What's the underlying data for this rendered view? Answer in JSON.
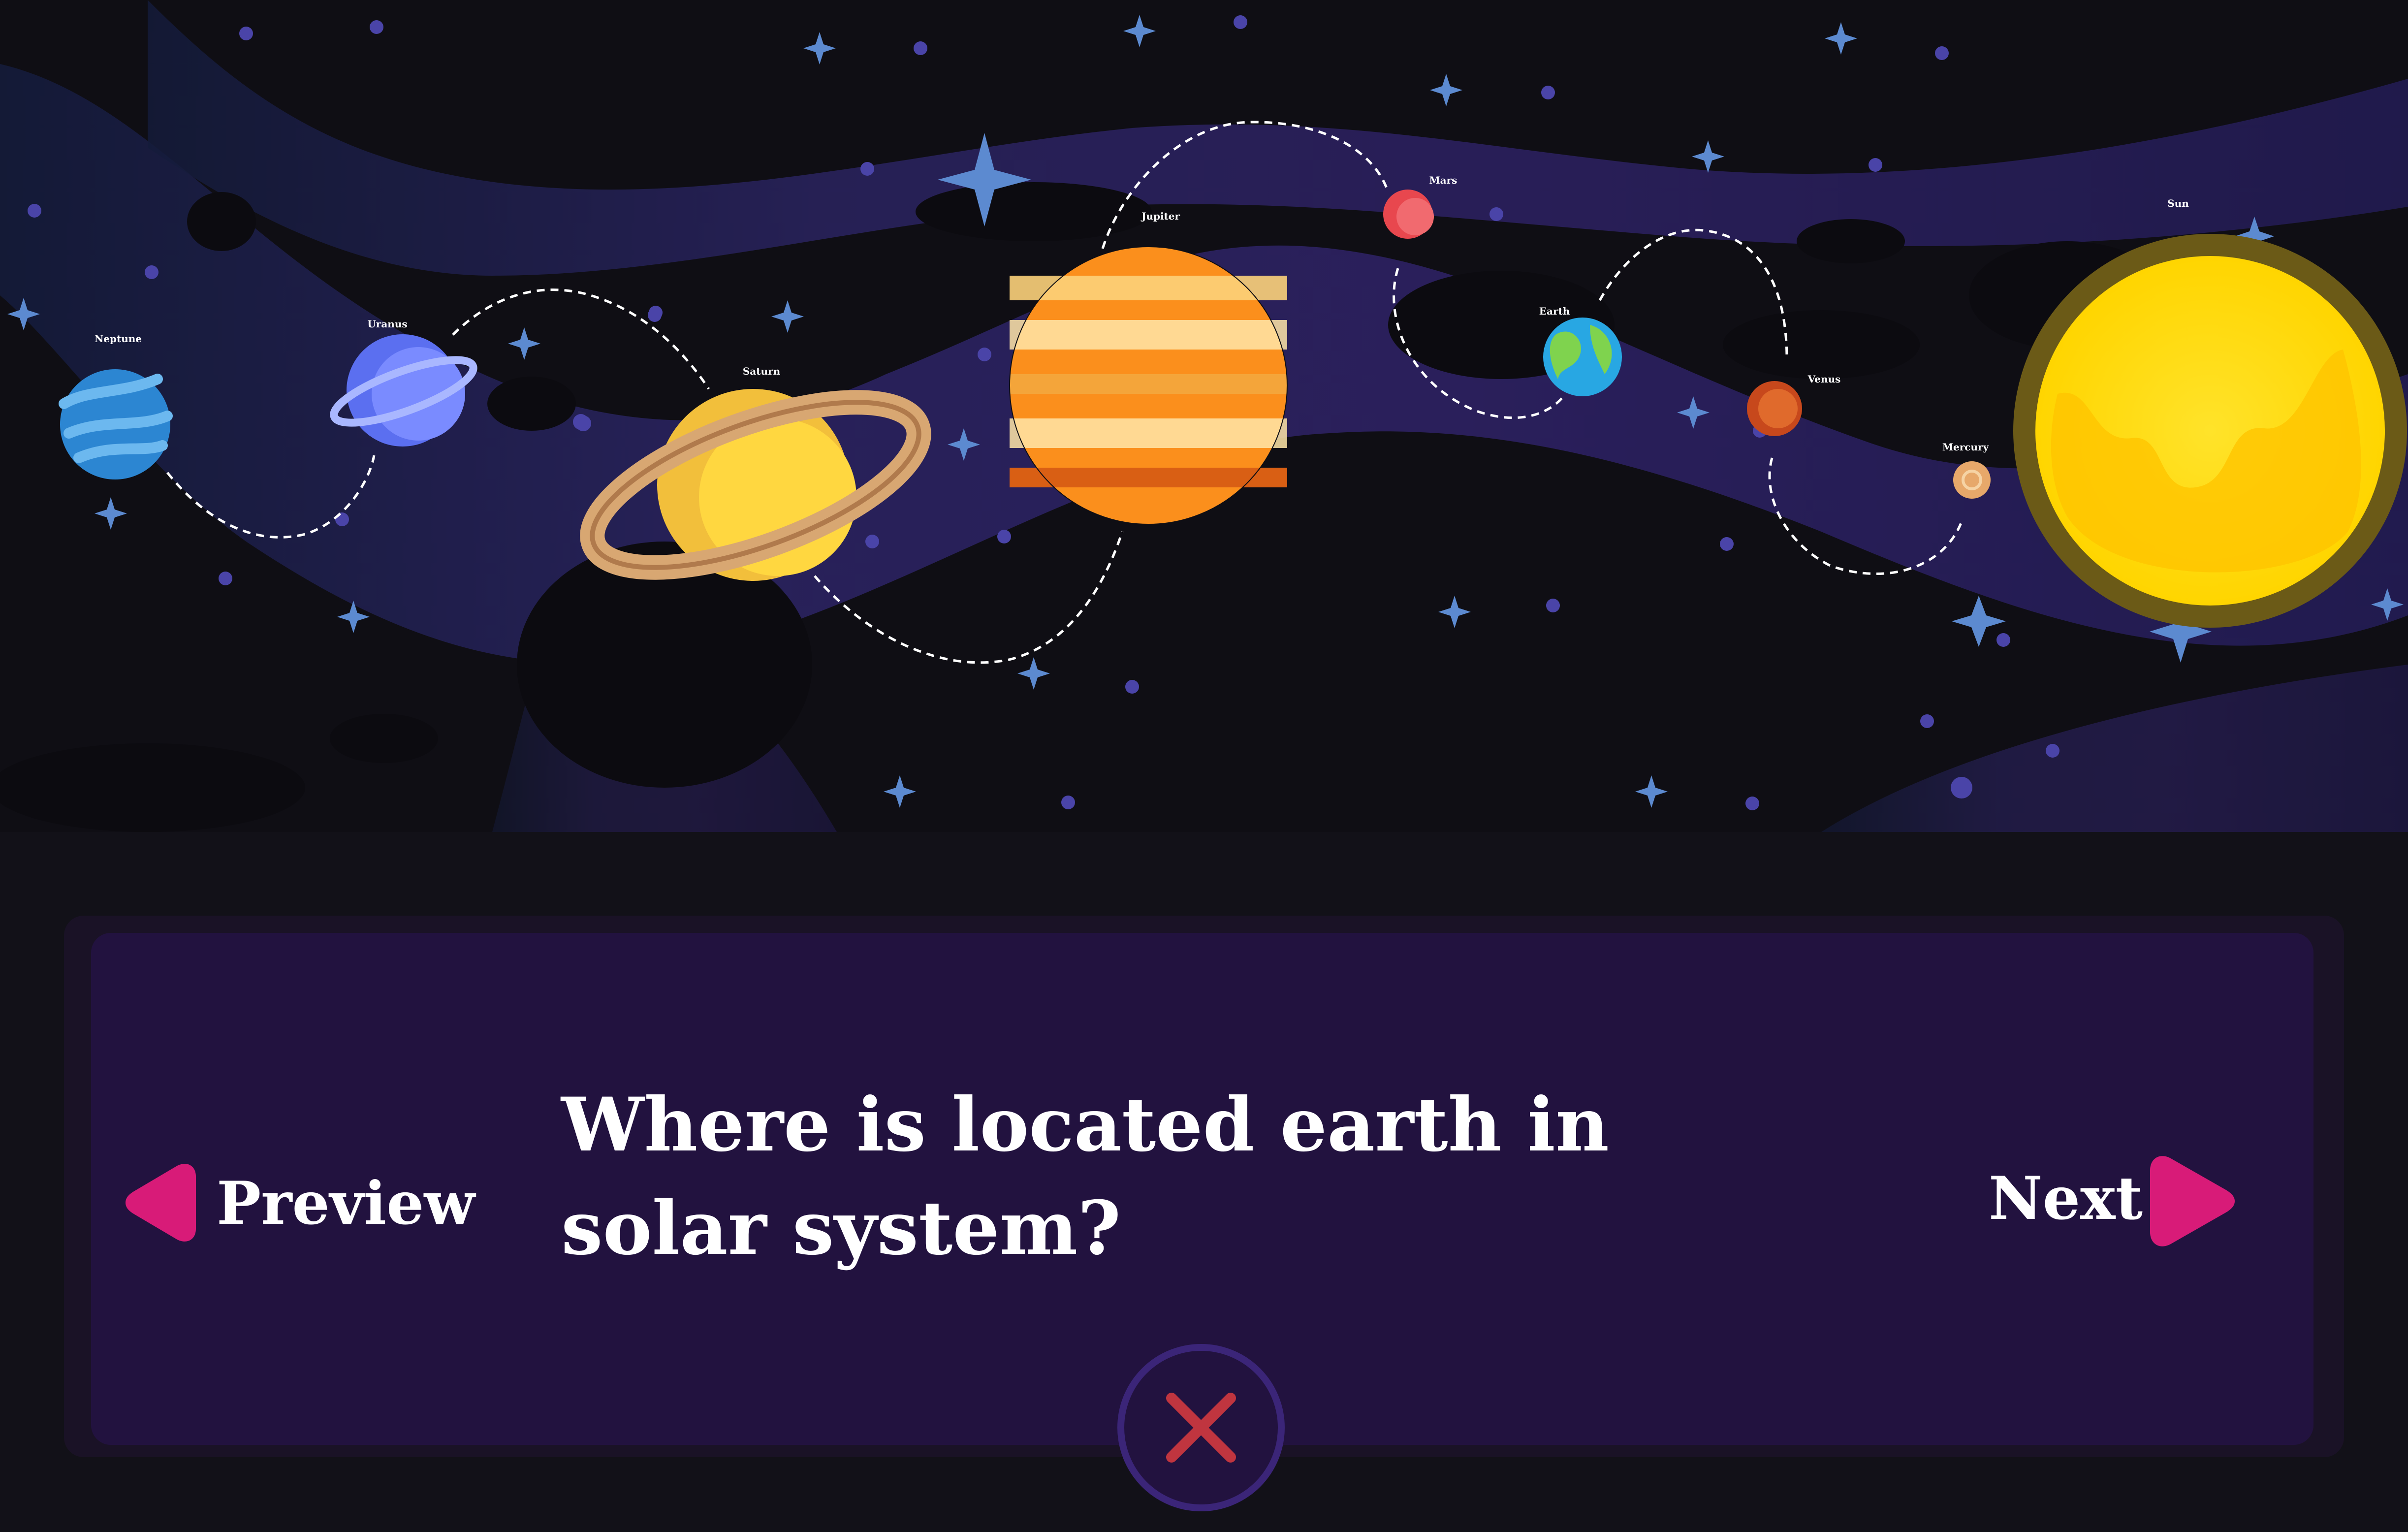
{
  "scene": {
    "planets": [
      {
        "name": "Neptune"
      },
      {
        "name": "Uranus"
      },
      {
        "name": "Saturn"
      },
      {
        "name": "Jupiter"
      },
      {
        "name": "Mars"
      },
      {
        "name": "Earth"
      },
      {
        "name": "Venus"
      },
      {
        "name": "Mercury"
      },
      {
        "name": "Sun"
      }
    ]
  },
  "quiz": {
    "question": "Where is located earth in solar system?"
  },
  "navigation": {
    "preview_label": "Preview",
    "next_label": "Next"
  },
  "colors": {
    "panel": "#22123f",
    "arrow_accent": "#d81b78",
    "close_icon": "#c0353f",
    "close_ring": "#3b2578"
  },
  "icons": {
    "preview": "triangle-left-icon",
    "next": "triangle-right-icon",
    "close": "close-x-icon"
  }
}
